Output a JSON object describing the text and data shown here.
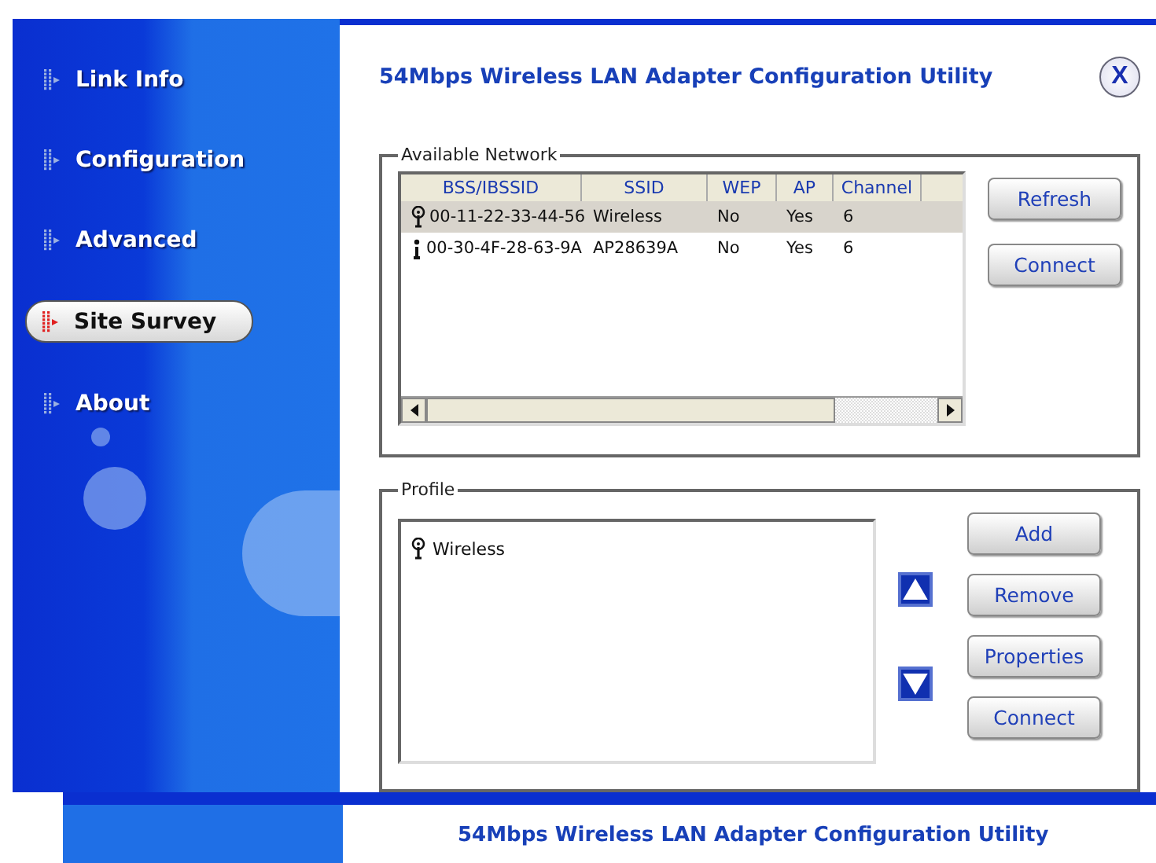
{
  "sidebar": {
    "items": [
      {
        "label": "Link Info",
        "selected": false
      },
      {
        "label": "Configuration",
        "selected": false
      },
      {
        "label": "Advanced",
        "selected": false
      },
      {
        "label": "Site Survey",
        "selected": true
      },
      {
        "label": "About",
        "selected": false
      }
    ]
  },
  "window": {
    "title": "54Mbps Wireless LAN Adapter Configuration Utility",
    "close": "X"
  },
  "available_network": {
    "title": "Available Network",
    "columns": [
      "BSS/IBSSID",
      "SSID",
      "WEP",
      "AP",
      "Channel"
    ],
    "rows": [
      {
        "kind": "antenna",
        "cells": [
          "00-11-22-33-44-56",
          "Wireless",
          "No",
          "Yes",
          "6"
        ],
        "selected": true
      },
      {
        "kind": "station",
        "cells": [
          "00-30-4F-28-63-9A",
          "AP28639A",
          "No",
          "Yes",
          "6"
        ],
        "selected": false
      }
    ],
    "buttons": [
      "Refresh",
      "Connect"
    ]
  },
  "profile": {
    "title": "Profile",
    "items": [
      {
        "label": "Wireless"
      }
    ],
    "buttons": [
      "Add",
      "Remove",
      "Properties",
      "Connect"
    ]
  },
  "second_window": {
    "title": "54Mbps Wireless LAN Adapter Configuration Utility"
  }
}
